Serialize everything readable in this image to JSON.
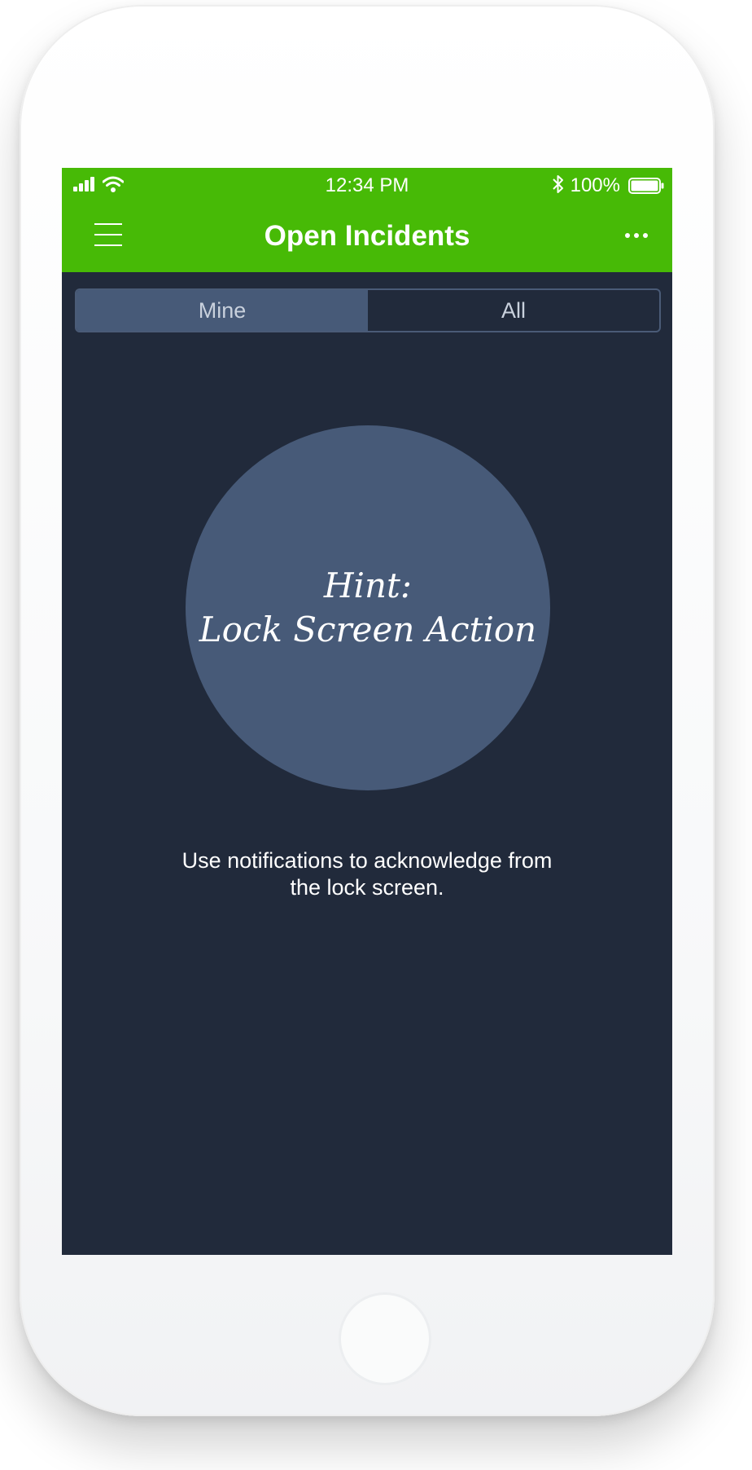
{
  "status_bar": {
    "time": "12:34 PM",
    "battery_percent": "100%",
    "signal_icon": "signal-bars-icon",
    "wifi_icon": "wifi-icon",
    "bluetooth_icon": "bluetooth-icon",
    "battery_icon": "battery-icon"
  },
  "nav": {
    "title": "Open Incidents",
    "menu_icon": "hamburger-menu-icon",
    "more_icon": "ellipsis-icon"
  },
  "segmented_control": {
    "options": [
      {
        "label": "Mine",
        "selected": true
      },
      {
        "label": "All",
        "selected": false
      }
    ]
  },
  "hint": {
    "title": "Hint:",
    "subtitle": "Lock Screen Action",
    "caption_line1": "Use notifications to acknowledge from",
    "caption_line2": "the lock screen."
  },
  "colors": {
    "header_green": "#47ba06",
    "background_navy": "#212a3b",
    "accent_slate": "#475a78"
  }
}
